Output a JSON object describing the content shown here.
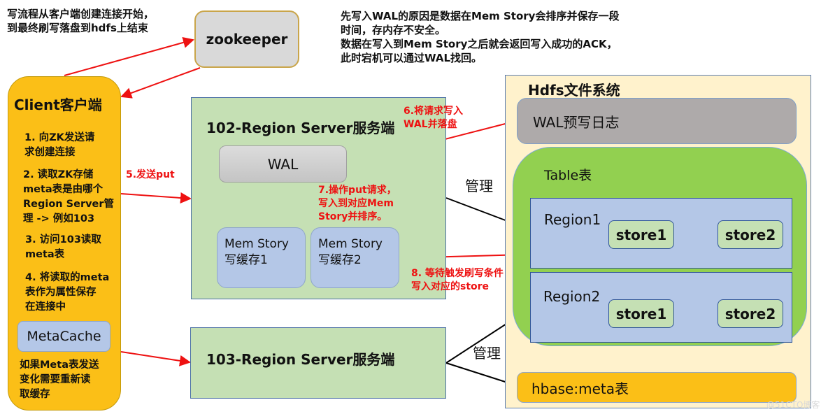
{
  "intro_note": "写流程从客户端创建连接开始，\n到最终刷写落盘到hdfs上结束",
  "wal_reason_note": "先写入WAL的原因是数据在Mem Story会排序并保存一段\n时间，存内存不安全。\n数据在写入到Mem Story之后就会返回写入成功的ACK，\n此时宕机可以通过WAL找回。",
  "zookeeper": {
    "label": "zookeeper"
  },
  "client": {
    "title": "Client客户端",
    "steps": [
      "1. 向ZK发送请\n求创建连接",
      "2. 读取ZK存储\nmeta表是由哪个\nRegion Server管\n理 -> 例如103",
      "3. 访问103读取\nmeta表",
      "4. 将读取的meta\n表作为属性保存\n在连接中"
    ],
    "metacache": "MetaCache",
    "footer": "如果Meta表发送\n变化需要重新读\n取缓存"
  },
  "region_server_102": {
    "title": "102-Region Server服务端",
    "wal": "WAL",
    "memstores": [
      "Mem Story\n写缓存1",
      "Mem Story\n写缓存2"
    ]
  },
  "region_server_103": {
    "title": "103-Region Server服务端"
  },
  "steps": {
    "step5": "5.发送put",
    "step6": "6.将请求写入\nWAL并落盘",
    "step7": "7.操作put请求，\n写入到对应Mem\nStory并排序。",
    "step8": "8. 等待触发刷写条件\n写入对应的store"
  },
  "manage_labels": [
    "管理",
    "管理"
  ],
  "hdfs": {
    "title": "Hdfs文件系统",
    "wal_log": "WAL预写日志",
    "table": {
      "title": "Table表",
      "regions": [
        {
          "label": "Region1",
          "stores": [
            "store1",
            "store2"
          ]
        },
        {
          "label": "Region2",
          "stores": [
            "store1",
            "store2"
          ]
        }
      ]
    },
    "meta_table": "hbase:meta表"
  },
  "watermark": "@51CTO博客",
  "colors": {
    "arrow_red": "#ee1111",
    "arrow_black": "#000000"
  }
}
